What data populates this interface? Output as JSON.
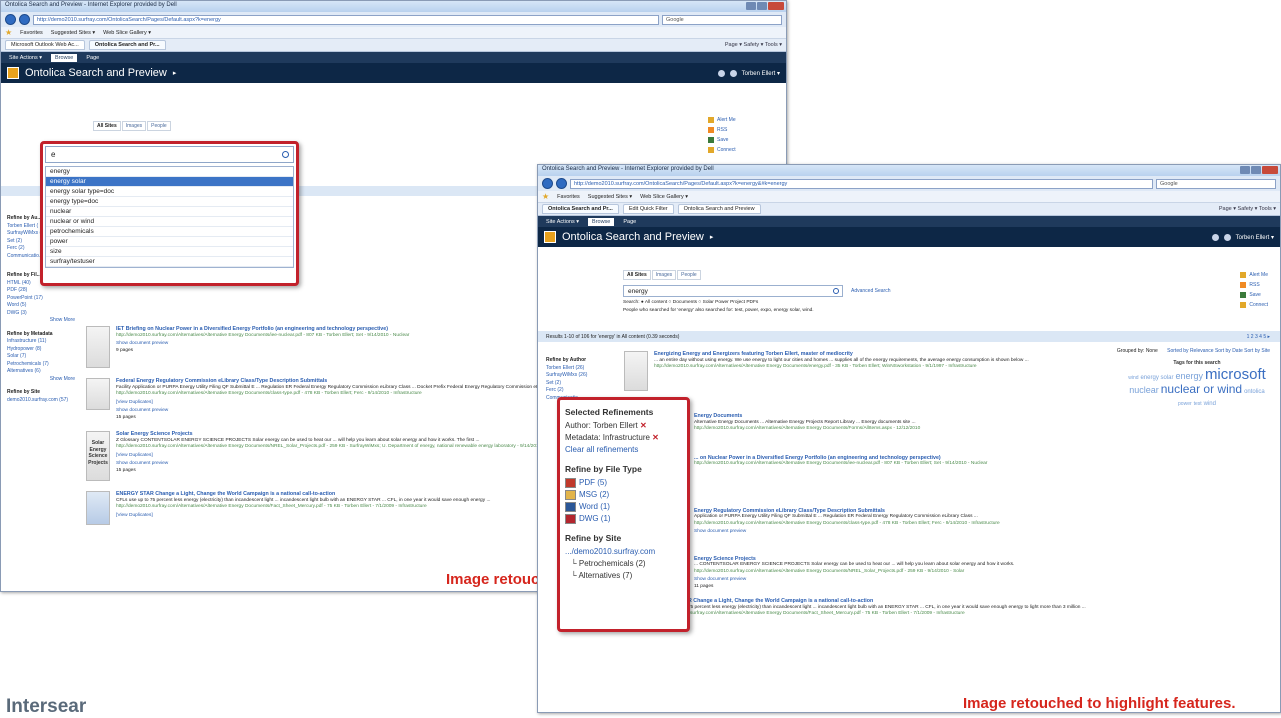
{
  "window1": {
    "titlebar": "Ontolica Search and Preview - Internet Explorer provided by Dell",
    "url": "http://demo2010.surfray.com/OntolicaSearch/Pages/Default.aspx?k=energy",
    "search_provider": "Google",
    "favorites": [
      "Favorites",
      "Suggested Sites ▾",
      "Web Slice Gallery ▾"
    ],
    "tabs": [
      "Microsoft Outlook Web Ac...",
      "Ontolica Search and Pr..."
    ],
    "cmdbar": "Page ▾  Safety ▾  Tools ▾",
    "ribbon": [
      "Site Actions ▾",
      "Browse",
      "Page"
    ],
    "site_title": "Ontolica Search and Preview",
    "user": "Torben Ellert ▾",
    "scope_tabs": [
      "All Sites",
      "Images",
      "People"
    ],
    "quick_links": [
      "Alert Me",
      "RSS",
      "Save",
      "Connect"
    ],
    "search_value": "e",
    "suggestions": [
      "energy",
      "energy solar",
      "energy solar type=doc",
      "energy type=doc",
      "nuclear",
      "nuclear or wind",
      "petrochemicals",
      "power",
      "size",
      "surfray/testuser"
    ],
    "refine": [
      {
        "heading": "Refine by Au...",
        "items": [
          "Torben Ellert (",
          "SurfrayWiMxs (",
          "Set (2)",
          "Ferc (2)",
          "Communicatio..."
        ]
      },
      {
        "heading": "Refine by Fil...",
        "items": [
          "HTML (40)",
          "PDF (28)",
          "PowerPoint (17)",
          "Word (5)",
          "DWG (3)"
        ],
        "more": "Show More"
      },
      {
        "heading": "Refine by Metadata",
        "items": [
          "Infrastructure (11)",
          "Hydropower (8)",
          "Solar (7)",
          "Petrochemicals (7)",
          "Alternatives (6)"
        ],
        "more": "Show More"
      },
      {
        "heading": "Refine by Site",
        "items": [
          "demo2010.surfray.com (57)"
        ]
      }
    ],
    "results": [
      {
        "title": "IET Briefing on Nuclear Power in a Diversified Energy Portfolio (an engineering and technology perspective)",
        "url": "http://demo2010.surfray.com/Alternatives/Alternative Energy Documents/iee-nuclear.pdf - 807 KB - Torben Ellert; Set - 9/14/2010 - Nuclear",
        "pages": "9 pages",
        "preview": "Show document preview"
      },
      {
        "title": "Federal Energy Regulatory Commission eLibrary Class/Type Description Submittals",
        "snippet": "Facility Application or PURPA Energy Utility Filing QF Submittal E ... Regulation ER Federal Energy Regulatory Commission eLibrary Class ... Docket Prefix Federal Energy Regulatory Commission eLibrary Class ...",
        "url": "http://demo2010.surfray.com/Alternatives/Alternative Energy Documents/class-type.pdf - 478 KB - Torben Ellert; Ferc - 9/14/2010 - Infrastructure",
        "dup": "[View Duplicates]",
        "pages": "15 pages",
        "preview": "Show document preview"
      },
      {
        "title": "Solar Energy Science Projects",
        "snippet": "Z Glossary CONTENTSOLAR ENERGY SCIENCE PROJECTS Solar energy can be used to heat our ... will help you learn about solar energy and how it works. The first ...",
        "url": "http://demo2010.surfray.com/Alternatives/Alternative Energy Documents/NREL_Solar_Projects.pdf - 259 KB - SurfrayWiMxs; U. Department of energy, national renewable energy laboratory - 9/14/2010 - Solar",
        "dup": "[View Duplicates]",
        "pages": "15 pages",
        "preview": "Show document preview",
        "thumb_text": "Solar Energy Science Projects"
      },
      {
        "title": "ENERGY STAR Change a Light, Change the World Campaign is a national call-to-action",
        "snippet": "CFLs use up to 75 percent less energy (electricity) than incandescent light ... incandescent light bulb with an ENERGY STAR ... CFL, in one year it would save enough energy ...",
        "url": "http://demo2010.surfray.com/Alternatives/Alternative Energy Documents/Fact_Sheet_Mercury.pdf - 75 KB - Torben Ellert - 7/1/2009 - Infrastructure",
        "dup": "[View Duplicates]"
      }
    ],
    "caption": "Image retouc"
  },
  "window2": {
    "titlebar": "Ontolica Search and Preview - Internet Explorer provided by Dell",
    "url": "http://demo2010.surfray.com/OntolicaSearch/Pages/Default.aspx?k=energy&#k=energy",
    "search_provider": "Google",
    "tabs": [
      "Ontolica Search and Pr...",
      "Edit Quick Filter",
      "Ontolica Search and Preview"
    ],
    "cmdbar": "Page ▾  Safety ▾  Tools ▾",
    "ribbon": [
      "Site Actions ▾",
      "Browse",
      "Page"
    ],
    "site_title": "Ontolica Search and Preview",
    "user": "Torben Ellert ▾",
    "scope_tabs": [
      "All Sites",
      "Images",
      "People"
    ],
    "search_value": "energy",
    "advanced": "Advanced Search",
    "search_scope": "Search: ● All content  ○ Documents  ○ Solar Power Project PDFs",
    "also_searched": "People who searched for 'energy' also searched for: test, power, expo, energy solar, wind.",
    "quick_links": [
      "Alert Me",
      "RSS",
      "Save",
      "Connect"
    ],
    "results_summary": "Results 1-10 of 106 for 'energy' in All content (0.39 seconds)",
    "pager": "1 2 3 4 5 ▸",
    "grouped_by": "Grouped by: None",
    "sorted_by": "Sorted by Relevance  Sort by Date  Sort by Site",
    "tags_heading": "Tags for this search",
    "tags": [
      "wind",
      "energy solar",
      "energy",
      "microsoft",
      "nuclear",
      "nuclear or wind",
      "ontolica",
      "power",
      "test",
      "wind"
    ],
    "refine_author_heading": "Refine by Author",
    "refine_author_items": [
      "Torben Ellert (26)",
      "SurfrayWiMxs (26)",
      "Set (2)",
      "Ferc (2)",
      "Communicatio..."
    ],
    "results": [
      {
        "title": "Energizing Energy and Energizers featuring Torben Ellert, master of mediocrity",
        "snippet": "... an entire day without using energy. We use energy to light our cities and homes ... supplies all of the energy requirements, the average energy consumption is shown below ...",
        "url": "http://demo2010.surfray.com/Alternatives/Alternative Energy Documents/energy.pdf - 35 KB - Torben Ellert; WinNSworkstation - 9/1/1997 - Infrastructure"
      },
      {
        "title": "Energy Documents",
        "snippet": "Alternative Energy Documents ... Alternative Energy Projects Report Library ... Energy documents site ...",
        "url": "http://demo2010.surfray.com/Alternatives/Alternative Energy Documents/Forms/AllItems.aspx - 12/12/2010"
      },
      {
        "title": "... on Nuclear Power in a Diversified Energy Portfolio (an engineering and technology perspective)",
        "url": "http://demo2010.surfray.com/Alternatives/Alternative Energy Documents/iee-nuclear.pdf - 807 KB - Torben Ellert; Set - 9/14/2010 - Nuclear"
      },
      {
        "title": "Energy Regulatory Commission eLibrary Class/Type Description Submittals",
        "snippet": "Application or PURPA Energy Utility Filing QF Submittal E ... Regulation ER Federal Energy Regulatory Commission eLibrary Class ...",
        "url": "http://demo2010.surfray.com/Alternatives/Alternative Energy Documents/class-type.pdf - 478 KB - Torben Ellert; Ferc - 9/14/2010 - Infrastructure"
      },
      {
        "title": "Energy Science Projects",
        "snippet": "... CONTENTSOLAR ENERGY SCIENCE PROJECTS Solar energy can be used to heat our ... will help you learn about solar energy and how it works.",
        "url": "http://demo2010.surfray.com/Alternatives/Alternative Energy Documents/NREL_Solar_Projects.pdf - 259 KB - 9/14/2010 - Solar"
      },
      {
        "title": "ENERGY STAR Change a Light, Change the World Campaign is a national call-to-action",
        "snippet": "CFLs use up to 75 percent less energy (electricity) than incandescent light ... incandescent light bulb with an ENERGY STAR ... CFL, in one year it would save enough energy to light more than 3 million ...",
        "url": "http://demo2010.surfray.com/Alternatives/Alternative Energy Documents/Fact_Sheet_Mercury.pdf - 75 KB - Torben Ellert - 7/1/2009 - Infrastructure"
      }
    ],
    "show_preview": "Show document preview",
    "pages": "11 pages",
    "refinements": {
      "selected_heading": "Selected Refinements",
      "author": "Author: Torben Ellert",
      "metadata": "Metadata: Infrastructure",
      "clear": "Clear all refinements",
      "filetype_heading": "Refine by File Type",
      "filetypes": [
        "PDF (5)",
        "MSG (2)",
        "Word (1)",
        "DWG (1)"
      ],
      "site_heading": "Refine by Site",
      "site_root": ".../demo2010.surfray.com",
      "sites": [
        "Petrochemicals (2)",
        "Alternatives (7)"
      ]
    },
    "caption": "Image retouched to highlight features."
  },
  "bottom_title": "Intersear",
  "colors": {
    "highlight_border": "#c2212b",
    "caption": "#d6261d",
    "link": "#2a5db0",
    "site_header": "#0d2746"
  }
}
